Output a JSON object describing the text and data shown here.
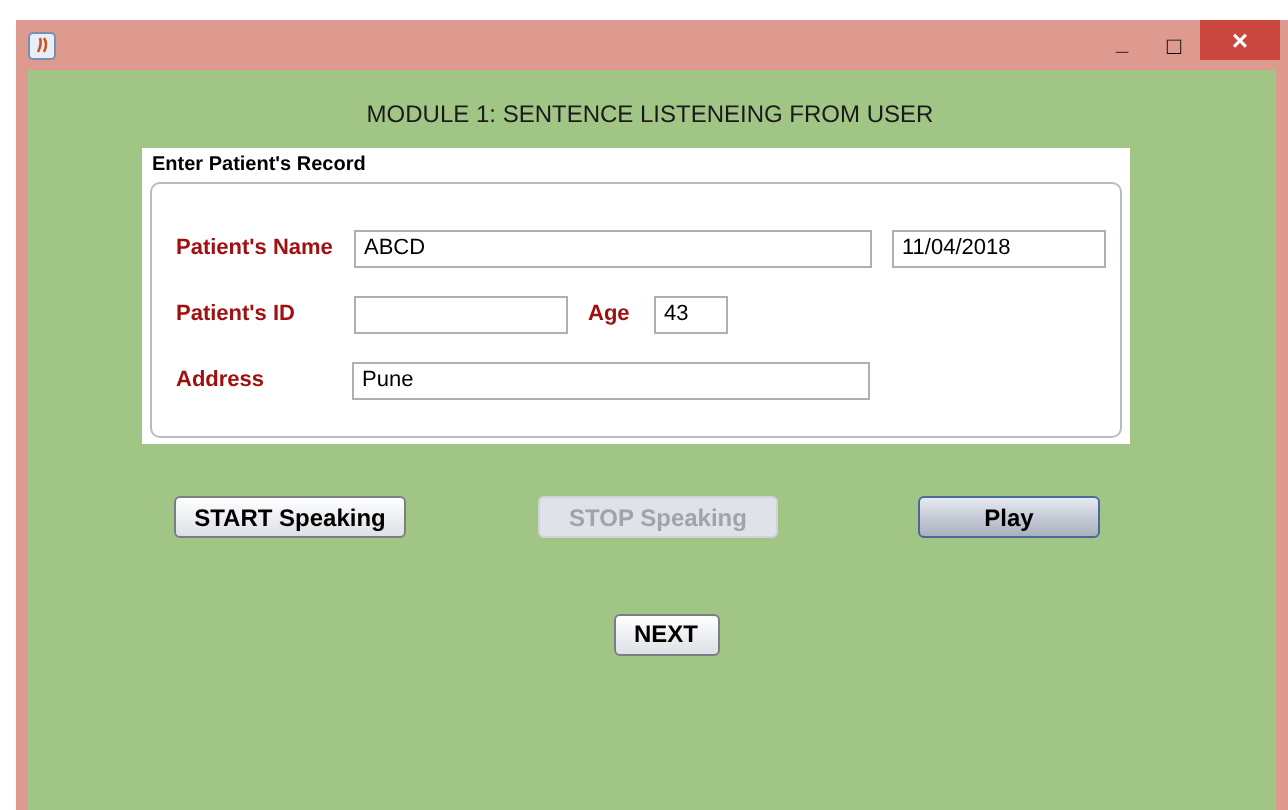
{
  "window": {
    "title_bar_buttons": [
      "_",
      "□",
      "×"
    ]
  },
  "heading": "MODULE 1: SENTENCE LISTENEING FROM USER",
  "record": {
    "title": "Enter Patient's Record",
    "name": {
      "label": "Patient's Name",
      "value": "ABCD"
    },
    "date": {
      "value": "11/04/2018"
    },
    "id": {
      "label": "Patient's ID"
    },
    "age": {
      "label": "Age",
      "value": "43"
    },
    "address": {
      "label": "Address",
      "value": "Pune"
    }
  },
  "buttons": [
    {
      "label": "START Speaking",
      "disabled": false,
      "focused": false
    },
    {
      "label": "STOP Speaking",
      "disabled": true,
      "focused": false
    },
    {
      "label": "Play",
      "disabled": false,
      "focused": true
    }
  ],
  "next_button": {
    "label": "NEXT",
    "disabled": false,
    "focused": false
  }
}
